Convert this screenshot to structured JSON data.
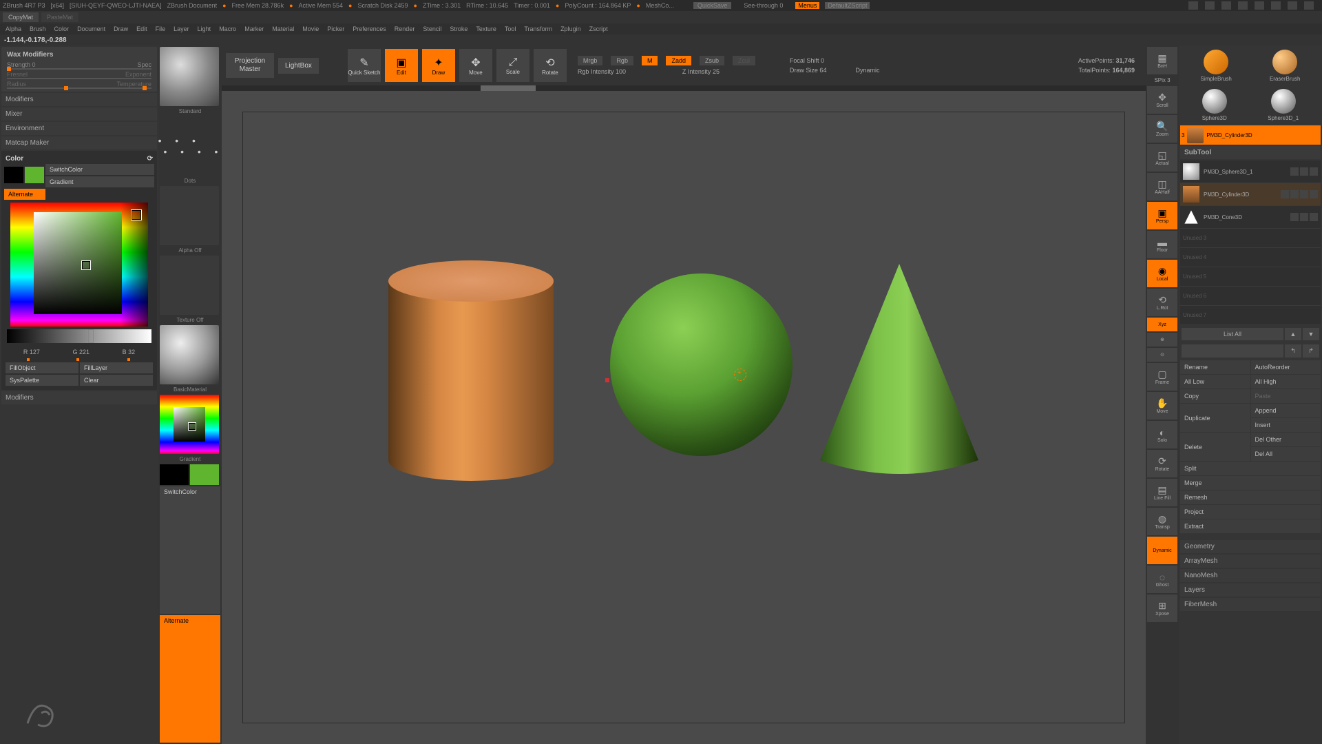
{
  "titlebar": {
    "app": "ZBrush 4R7 P3",
    "arch": "[x64]",
    "doc": "[SIUH-QEYF-QWEO-LJTI-NAEA]",
    "title": "ZBrush Document",
    "free_mem": "Free Mem 28.786k",
    "active_mem": "Active Mem 554",
    "scratch": "Scratch Disk 2459",
    "ztime": "ZTime : 3.301",
    "rtime": "RTime : 10.645",
    "timer": "Timer : 0.001",
    "polycount": "PolyCount : 164.864 KP",
    "meshco": "MeshCo...",
    "quicksave": "QuickSave",
    "seethrough": "See-through   0",
    "menus": "Menus",
    "script": "DefaultZScript"
  },
  "copymat": "CopyMat",
  "pastemat": "PasteMat",
  "menubar": [
    "Alpha",
    "Brush",
    "Color",
    "Document",
    "Draw",
    "Edit",
    "File",
    "Layer",
    "Light",
    "Macro",
    "Marker",
    "Material",
    "Movie",
    "Picker",
    "Preferences",
    "Render",
    "Stencil",
    "Stroke",
    "Texture",
    "Tool",
    "Transform",
    "Zplugin",
    "Zscript"
  ],
  "coords": "-1.144,-0.178,-0.288",
  "left": {
    "wax": "Wax Modifiers",
    "strength": "Strength 0",
    "spec": "Spec",
    "fresnel": "Fresnel",
    "exponent": "Exponent",
    "radius": "Radius",
    "temperature": "Temperature",
    "modifiers": "Modifiers",
    "mixer": "Mixer",
    "environment": "Environment",
    "matcap": "Matcap Maker",
    "color": "Color",
    "switchcolor": "SwitchColor",
    "gradient": "Gradient",
    "alternate": "Alternate",
    "r": "R 127",
    "g": "G 221",
    "b": "B 32",
    "fillobject": "FillObject",
    "filllayer": "FillLayer",
    "syspalette": "SysPalette",
    "clear": "Clear",
    "modifiers2": "Modifiers"
  },
  "toolcol": {
    "standard": "Standard",
    "dots": "Dots",
    "alpha": "Alpha  Off",
    "texture": "Texture  Off",
    "basicmat": "BasicMaterial",
    "gradient": "Gradient",
    "switchcolor": "SwitchColor",
    "alternate": "Alternate"
  },
  "toolbar": {
    "projection": "Projection Master",
    "lightbox": "LightBox",
    "quicksketch": "Quick Sketch",
    "edit": "Edit",
    "draw": "Draw",
    "move": "Move",
    "scale": "Scale",
    "rotate": "Rotate",
    "mrgb": "Mrgb",
    "rgb": "Rgb",
    "m": "M",
    "zadd": "Zadd",
    "zsub": "Zsub",
    "zcul": "Zcul",
    "rgb_int": "Rgb Intensity 100",
    "z_int": "Z Intensity 25",
    "focal": "Focal Shift 0",
    "draw_size": "Draw Size 64",
    "dynamic": "Dynamic",
    "active": "ActivePoints:",
    "active_v": "31,746",
    "total": "TotalPoints:",
    "total_v": "164,869"
  },
  "rtools": {
    "bnh": "BnH",
    "spix": "SPix 3",
    "scroll": "Scroll",
    "zoom": "Zoom",
    "actual": "Actual",
    "aahalf": "AAHalf",
    "persp": "Persp",
    "floor": "Floor",
    "local": "Local",
    "lrot": "L.Rot",
    "xyz": "Xyz",
    "frame": "Frame",
    "move": "Move",
    "solo": "Solo",
    "rotate": "Rotate",
    "linefill": "Line Fill",
    "transp": "Transp",
    "dynamic": "Dynamic",
    "ghost": "Ghost",
    "xpose": "Xpose"
  },
  "rpanel": {
    "simplebrush": "SimpleBrush",
    "eraserbrush": "EraserBrush",
    "sphere3d": "Sphere3D",
    "sphere3d1": "Sphere3D_1",
    "cyl": "PM3D_Cylinder3D",
    "subtool": "SubTool",
    "st_sphere": "PM3D_Sphere3D_1",
    "st_cyl": "PM3D_Cylinder3D",
    "st_cone": "PM3D_Cone3D",
    "unused3": "Unused  3",
    "unused4": "Unused  4",
    "unused5": "Unused  5",
    "unused6": "Unused  6",
    "unused7": "Unused  7",
    "listall": "List All",
    "rename": "Rename",
    "autoreorder": "AutoReorder",
    "alllow": "All Low",
    "allhigh": "All High",
    "copy": "Copy",
    "paste": "Paste",
    "duplicate": "Duplicate",
    "append": "Append",
    "insert": "Insert",
    "delete": "Delete",
    "delother": "Del Other",
    "delall": "Del All",
    "split": "Split",
    "merge": "Merge",
    "remesh": "Remesh",
    "project": "Project",
    "extract": "Extract",
    "geometry": "Geometry",
    "arraymesh": "ArrayMesh",
    "nanomesh": "NanoMesh",
    "layers": "Layers",
    "fibermesh": "FiberMesh"
  }
}
